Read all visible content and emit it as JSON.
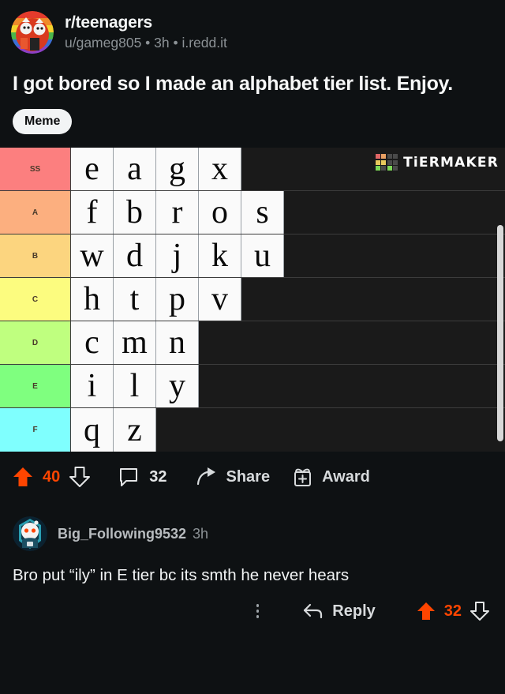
{
  "post": {
    "subreddit": "r/teenagers",
    "meta": "u/gameg805 • 3h • i.redd.it",
    "title": "I got bored so I made an alphabet tier list. Enjoy.",
    "flair": "Meme",
    "avatar_name": "subreddit-avatar"
  },
  "tierlist": {
    "watermark": "TiERMAKER",
    "watermark_grid_colors": [
      "#e06666",
      "#e8a063",
      "#4a4a4a",
      "#4a4a4a",
      "#e8c95c",
      "#e8c95c",
      "#4a4a4a",
      "#4a4a4a",
      "#7ed957",
      "#4a4a4a",
      "#7ed957",
      "#4a4a4a"
    ],
    "rows": [
      {
        "label": "SS",
        "color": "#fc7f7f",
        "items": [
          "e",
          "a",
          "g",
          "x"
        ]
      },
      {
        "label": "A",
        "color": "#fcaf7f",
        "items": [
          "f",
          "b",
          "r",
          "o",
          "s"
        ]
      },
      {
        "label": "B",
        "color": "#fcd57f",
        "items": [
          "w",
          "d",
          "j",
          "k",
          "u"
        ]
      },
      {
        "label": "C",
        "color": "#fcfc7f",
        "items": [
          "h",
          "t",
          "p",
          "v"
        ]
      },
      {
        "label": "D",
        "color": "#bfff7f",
        "items": [
          "c",
          "m",
          "n"
        ]
      },
      {
        "label": "E",
        "color": "#7fff7f",
        "items": [
          "i",
          "l",
          "y"
        ]
      },
      {
        "label": "F",
        "color": "#7ffffe",
        "items": [
          "q",
          "z"
        ]
      }
    ]
  },
  "post_actions": {
    "upvote_icon": "upvote-arrow-icon",
    "score": "40",
    "downvote_icon": "downvote-arrow-icon",
    "comment_icon": "comment-bubble-icon",
    "comment_count": "32",
    "share_icon": "share-arrow-icon",
    "share_label": "Share",
    "award_icon": "award-gift-icon",
    "award_label": "Award"
  },
  "comment": {
    "avatar_name": "commenter-avatar",
    "username": "Big_Following9532",
    "time": "3h",
    "body": "Bro put “ily” in E tier bc its smth he never hears",
    "reply_label": "Reply",
    "score": "32",
    "more_icon": "kebab-menu-icon"
  },
  "colors": {
    "accent": "#ff4500",
    "background": "#0e1113",
    "text_primary": "#f2f4f5",
    "text_secondary": "#8c9296"
  }
}
